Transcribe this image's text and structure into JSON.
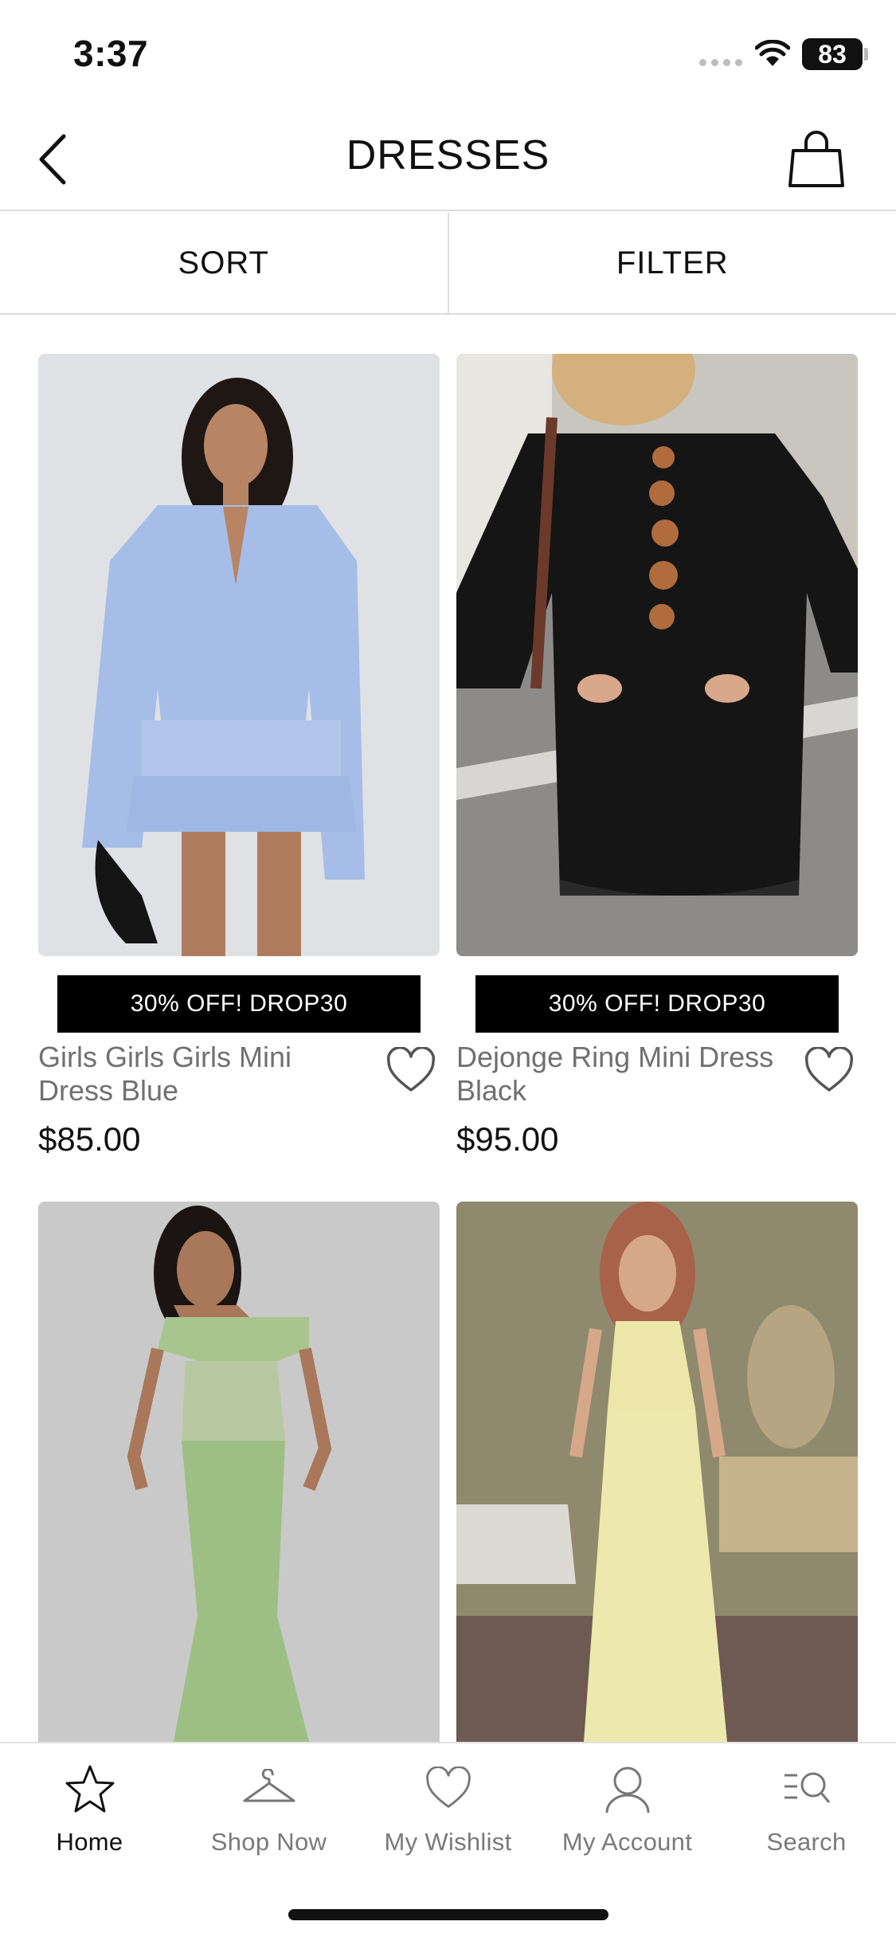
{
  "status_bar": {
    "time": "3:37",
    "battery": "83"
  },
  "header": {
    "title": "DRESSES"
  },
  "toolbar": {
    "sort_label": "SORT",
    "filter_label": "FILTER"
  },
  "products": [
    {
      "name": "Girls Girls Girls Mini Dress Blue",
      "price": "$85.00",
      "promo": "30% OFF! DROP30"
    },
    {
      "name": "Dejonge Ring Mini Dress Black",
      "price": "$95.00",
      "promo": "30% OFF! DROP30"
    },
    {
      "name": "",
      "price": "",
      "promo": ""
    },
    {
      "name": "",
      "price": "",
      "promo": ""
    }
  ],
  "tabs": [
    {
      "label": "Home",
      "icon": "star-icon",
      "active": true
    },
    {
      "label": "Shop Now",
      "icon": "hanger-icon",
      "active": false
    },
    {
      "label": "My Wishlist",
      "icon": "heart-icon",
      "active": false
    },
    {
      "label": "My Account",
      "icon": "person-icon",
      "active": false
    },
    {
      "label": "Search",
      "icon": "search-list-icon",
      "active": false
    }
  ],
  "colors": {
    "accent": "#000000",
    "muted_text": "#707070",
    "divider": "#dcdcdc"
  }
}
